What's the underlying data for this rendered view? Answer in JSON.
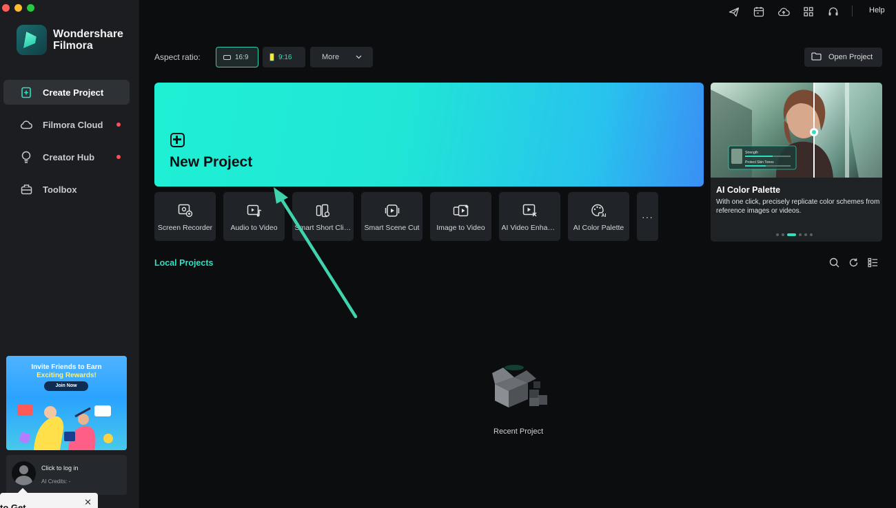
{
  "window": {
    "traffic_colors": [
      "#ff5f57",
      "#febc2e",
      "#28c840"
    ]
  },
  "brand": {
    "line1": "Wondershare",
    "line2": "Filmora"
  },
  "sidebar": {
    "items": [
      {
        "label": "Create Project",
        "icon": "create-project-icon",
        "active": true
      },
      {
        "label": "Filmora Cloud",
        "icon": "cloud-icon",
        "badge": true
      },
      {
        "label": "Creator Hub",
        "icon": "bulb-icon",
        "badge": true
      },
      {
        "label": "Toolbox",
        "icon": "toolbox-icon"
      }
    ],
    "promo": {
      "title": "Invite Friends to Earn",
      "subtitle": "Exciting Rewards!",
      "button": "Join Now"
    },
    "login": {
      "title": "Click to log in",
      "credits": "AI Credits: -"
    },
    "toast": {
      "text": "to Get",
      "close": "✕"
    }
  },
  "topbar": {
    "icons": [
      "send-icon",
      "calendar-icon",
      "cloud-upload-icon",
      "apps-grid-icon",
      "headset-icon"
    ],
    "help": "Help"
  },
  "aspect": {
    "label": "Aspect ratio:",
    "options": [
      "16:9",
      "9:16"
    ],
    "selected": "16:9",
    "more": "More"
  },
  "open_project": {
    "label": "Open Project"
  },
  "new_project": {
    "label": "New Project"
  },
  "tools": [
    {
      "label": "Screen Recorder",
      "icon": "screen-recorder-icon"
    },
    {
      "label": "Audio to Video",
      "icon": "audio-to-video-icon"
    },
    {
      "label": "Smart Short Clips",
      "icon": "smart-short-clips-icon"
    },
    {
      "label": "Smart Scene Cut",
      "icon": "smart-scene-cut-icon"
    },
    {
      "label": "Image to Video",
      "icon": "image-to-video-icon"
    },
    {
      "label": "AI Video Enhancer",
      "icon": "ai-video-enhancer-icon"
    },
    {
      "label": "AI Color Palette",
      "icon": "ai-color-palette-icon"
    }
  ],
  "tools_more": "···",
  "feature": {
    "title": "AI Color Palette",
    "description": "With one click, precisely replicate color schemes from reference images or videos.",
    "slides": 6,
    "active_slide": 2,
    "overlay_labels": [
      "Strength",
      "Protect Skin Tones"
    ]
  },
  "local": {
    "title": "Local Projects",
    "icons": [
      "search-icon",
      "refresh-icon",
      "list-view-icon"
    ],
    "empty_label": "Recent Project"
  },
  "colors": {
    "accent": "#2fe0c0",
    "badge": "#ff4d5b",
    "bg": "#0b0d0f",
    "sidebar": "#1b1d20"
  }
}
